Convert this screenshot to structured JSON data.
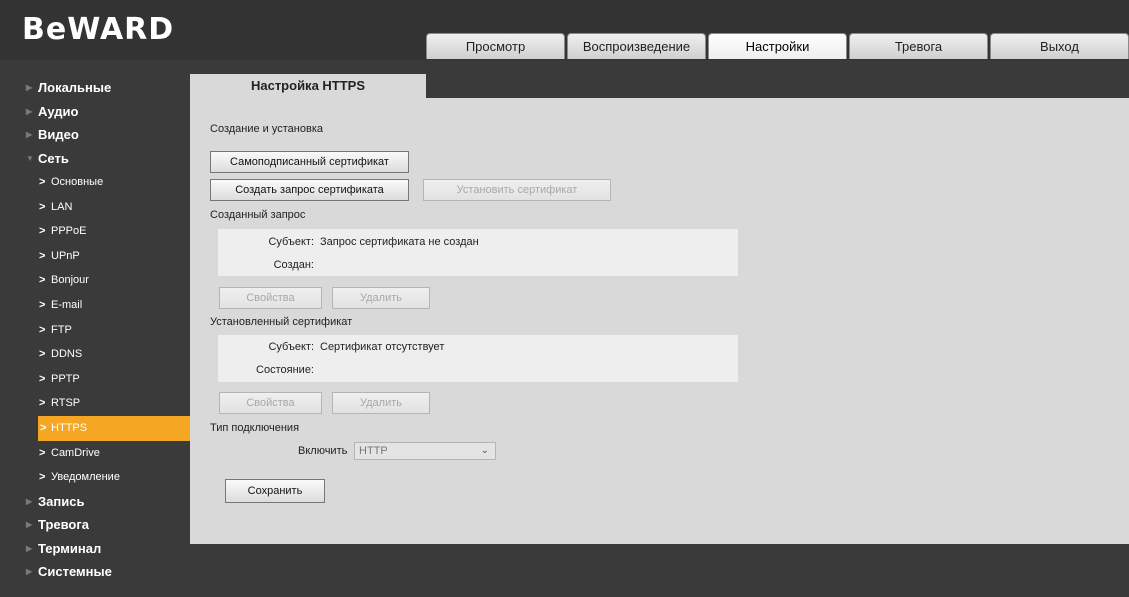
{
  "app": {
    "logo": "BeWARD"
  },
  "top_tabs": [
    "Просмотр",
    "Воспроизведение",
    "Настройки",
    "Тревога",
    "Выход"
  ],
  "active_top_tab": "Настройки",
  "sidebar": {
    "groups_top": [
      "Локальные",
      "Аудио",
      "Видео",
      "Сеть"
    ],
    "network_items": [
      "Основные",
      "LAN",
      "PPPoE",
      "UPnP",
      "Bonjour",
      "E-mail",
      "FTP",
      "DDNS",
      "PPTP",
      "RTSP",
      "HTTPS",
      "CamDrive",
      "Уведомление"
    ],
    "active_item": "HTTPS",
    "groups_bottom": [
      "Запись",
      "Тревога",
      "Терминал",
      "Системные"
    ],
    "accent": "#f5a623"
  },
  "page": {
    "tab_title": "Настройка HTTPS",
    "section_create": "Создание и установка",
    "btn_self_signed": "Самоподписанный сертификат",
    "btn_create_request": "Создать запрос сертификата",
    "btn_install_cert": "Установить сертификат",
    "created_request": {
      "heading": "Созданный запрос",
      "subject_label": "Субъект:",
      "subject_value": "Запрос сертификата не создан",
      "created_label": "Создан:",
      "created_value": ""
    },
    "btn_properties": "Свойства",
    "btn_delete": "Удалить",
    "installed_cert": {
      "heading": "Установленный сертификат",
      "subject_label": "Субъект:",
      "subject_value": "Сертификат отсутствует",
      "state_label": "Состояние:",
      "state_value": ""
    },
    "connection": {
      "heading": "Тип подключения",
      "enable_label": "Включить",
      "selected": "HTTP"
    },
    "btn_save": "Сохранить"
  }
}
